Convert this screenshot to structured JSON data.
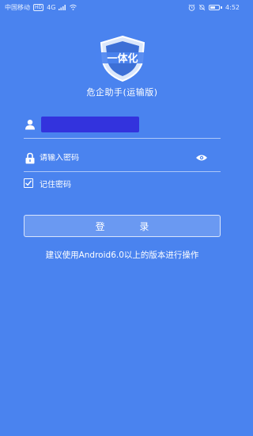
{
  "status_bar": {
    "carrier": "中国移动",
    "network_badge": "HD",
    "signal": "4G",
    "time": "4:52",
    "icons": [
      "alarm-icon",
      "silent-icon",
      "battery-icon"
    ],
    "battery_fraction": 0.55
  },
  "app": {
    "logo_text": "一体化",
    "title": "危企助手(运输版)",
    "theme_color": "#4a83ef"
  },
  "login_form": {
    "username_value": "",
    "username_masked": true,
    "password_placeholder": "请输入密码",
    "remember_label": "记住密码",
    "remember_checked": true,
    "login_label": "登 录"
  },
  "tip": "建议使用Android6.0以上的版本进行操作"
}
